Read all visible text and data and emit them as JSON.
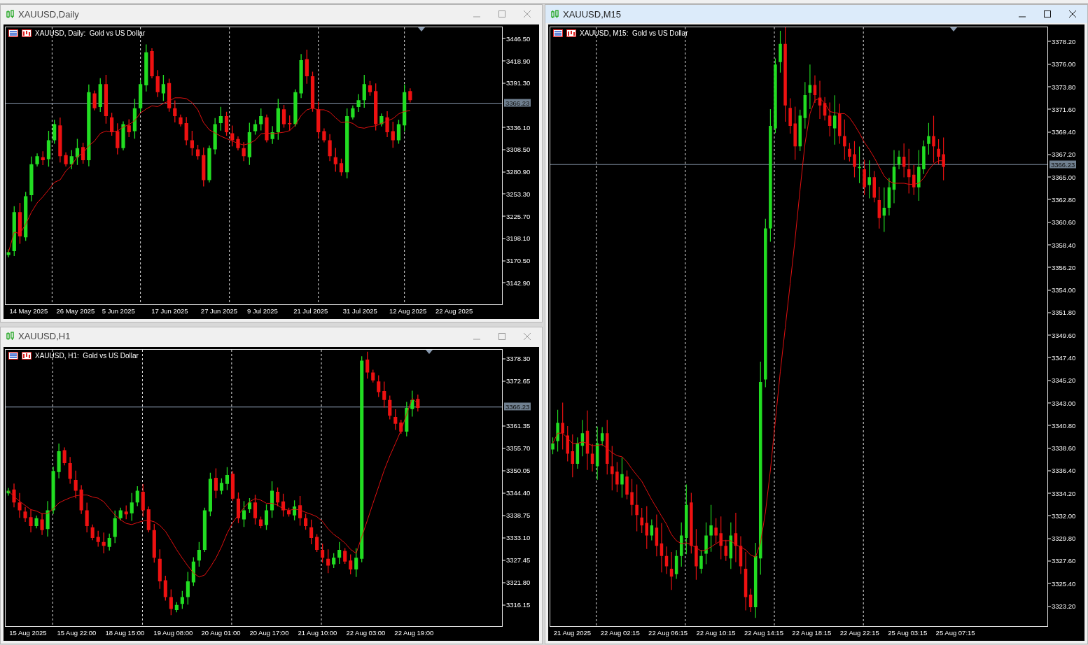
{
  "left_column": [
    {
      "title": "XAUUSD,Daily",
      "active": false,
      "chart": {
        "header": "XAUUSD, Daily:  Gold vs US Dollar",
        "price_label": "3366.23",
        "y_labels": [
          "3446.50",
          "3418.90",
          "3391.30",
          "3336.10",
          "3308.50",
          "3280.90",
          "3253.30",
          "3225.70",
          "3198.10",
          "3170.50",
          "3142.90"
        ],
        "x_labels": [
          "14 May 2025",
          "26 May 2025",
          "5 Jun 2025",
          "17 Jun 2025",
          "27 Jun 2025",
          "9 Jul 2025",
          "21 Jul 2025",
          "31 Jul 2025",
          "12 Aug 2025",
          "22 Aug 2025"
        ]
      }
    },
    {
      "title": "XAUUSD,H1",
      "active": false,
      "chart": {
        "header": "XAUUSD, H1:  Gold vs US Dollar",
        "price_label": "3366.23",
        "y_labels": [
          "3378.30",
          "3372.65",
          "3361.35",
          "3355.70",
          "3350.05",
          "3344.40",
          "3338.75",
          "3333.10",
          "3327.45",
          "3321.80",
          "3316.15"
        ],
        "x_labels": [
          "15 Aug 2025",
          "15 Aug 22:00",
          "18 Aug 15:00",
          "19 Aug 08:00",
          "20 Aug 01:00",
          "20 Aug 17:00",
          "21 Aug 10:00",
          "22 Aug 03:00",
          "22 Aug 19:00"
        ]
      }
    }
  ],
  "right_column": [
    {
      "title": "XAUUSD,M15",
      "active": true,
      "chart": {
        "header": "XAUUSD, M15:  Gold vs US Dollar",
        "price_label": "3366.23",
        "y_labels": [
          "3378.20",
          "3376.00",
          "3373.80",
          "3371.60",
          "3369.40",
          "3367.20",
          "3365.00",
          "3362.80",
          "3360.60",
          "3358.40",
          "3356.20",
          "3354.00",
          "3351.80",
          "3349.60",
          "3347.40",
          "3345.20",
          "3343.00",
          "3340.80",
          "3338.60",
          "3336.40",
          "3334.20",
          "3332.00",
          "3329.80",
          "3327.60",
          "3325.40",
          "3323.20"
        ],
        "x_labels": [
          "21 Aug 2025",
          "22 Aug 02:15",
          "22 Aug 06:15",
          "22 Aug 10:15",
          "22 Aug 14:15",
          "22 Aug 18:15",
          "22 Aug 22:15",
          "25 Aug 03:15",
          "25 Aug 07:15"
        ]
      }
    }
  ]
}
